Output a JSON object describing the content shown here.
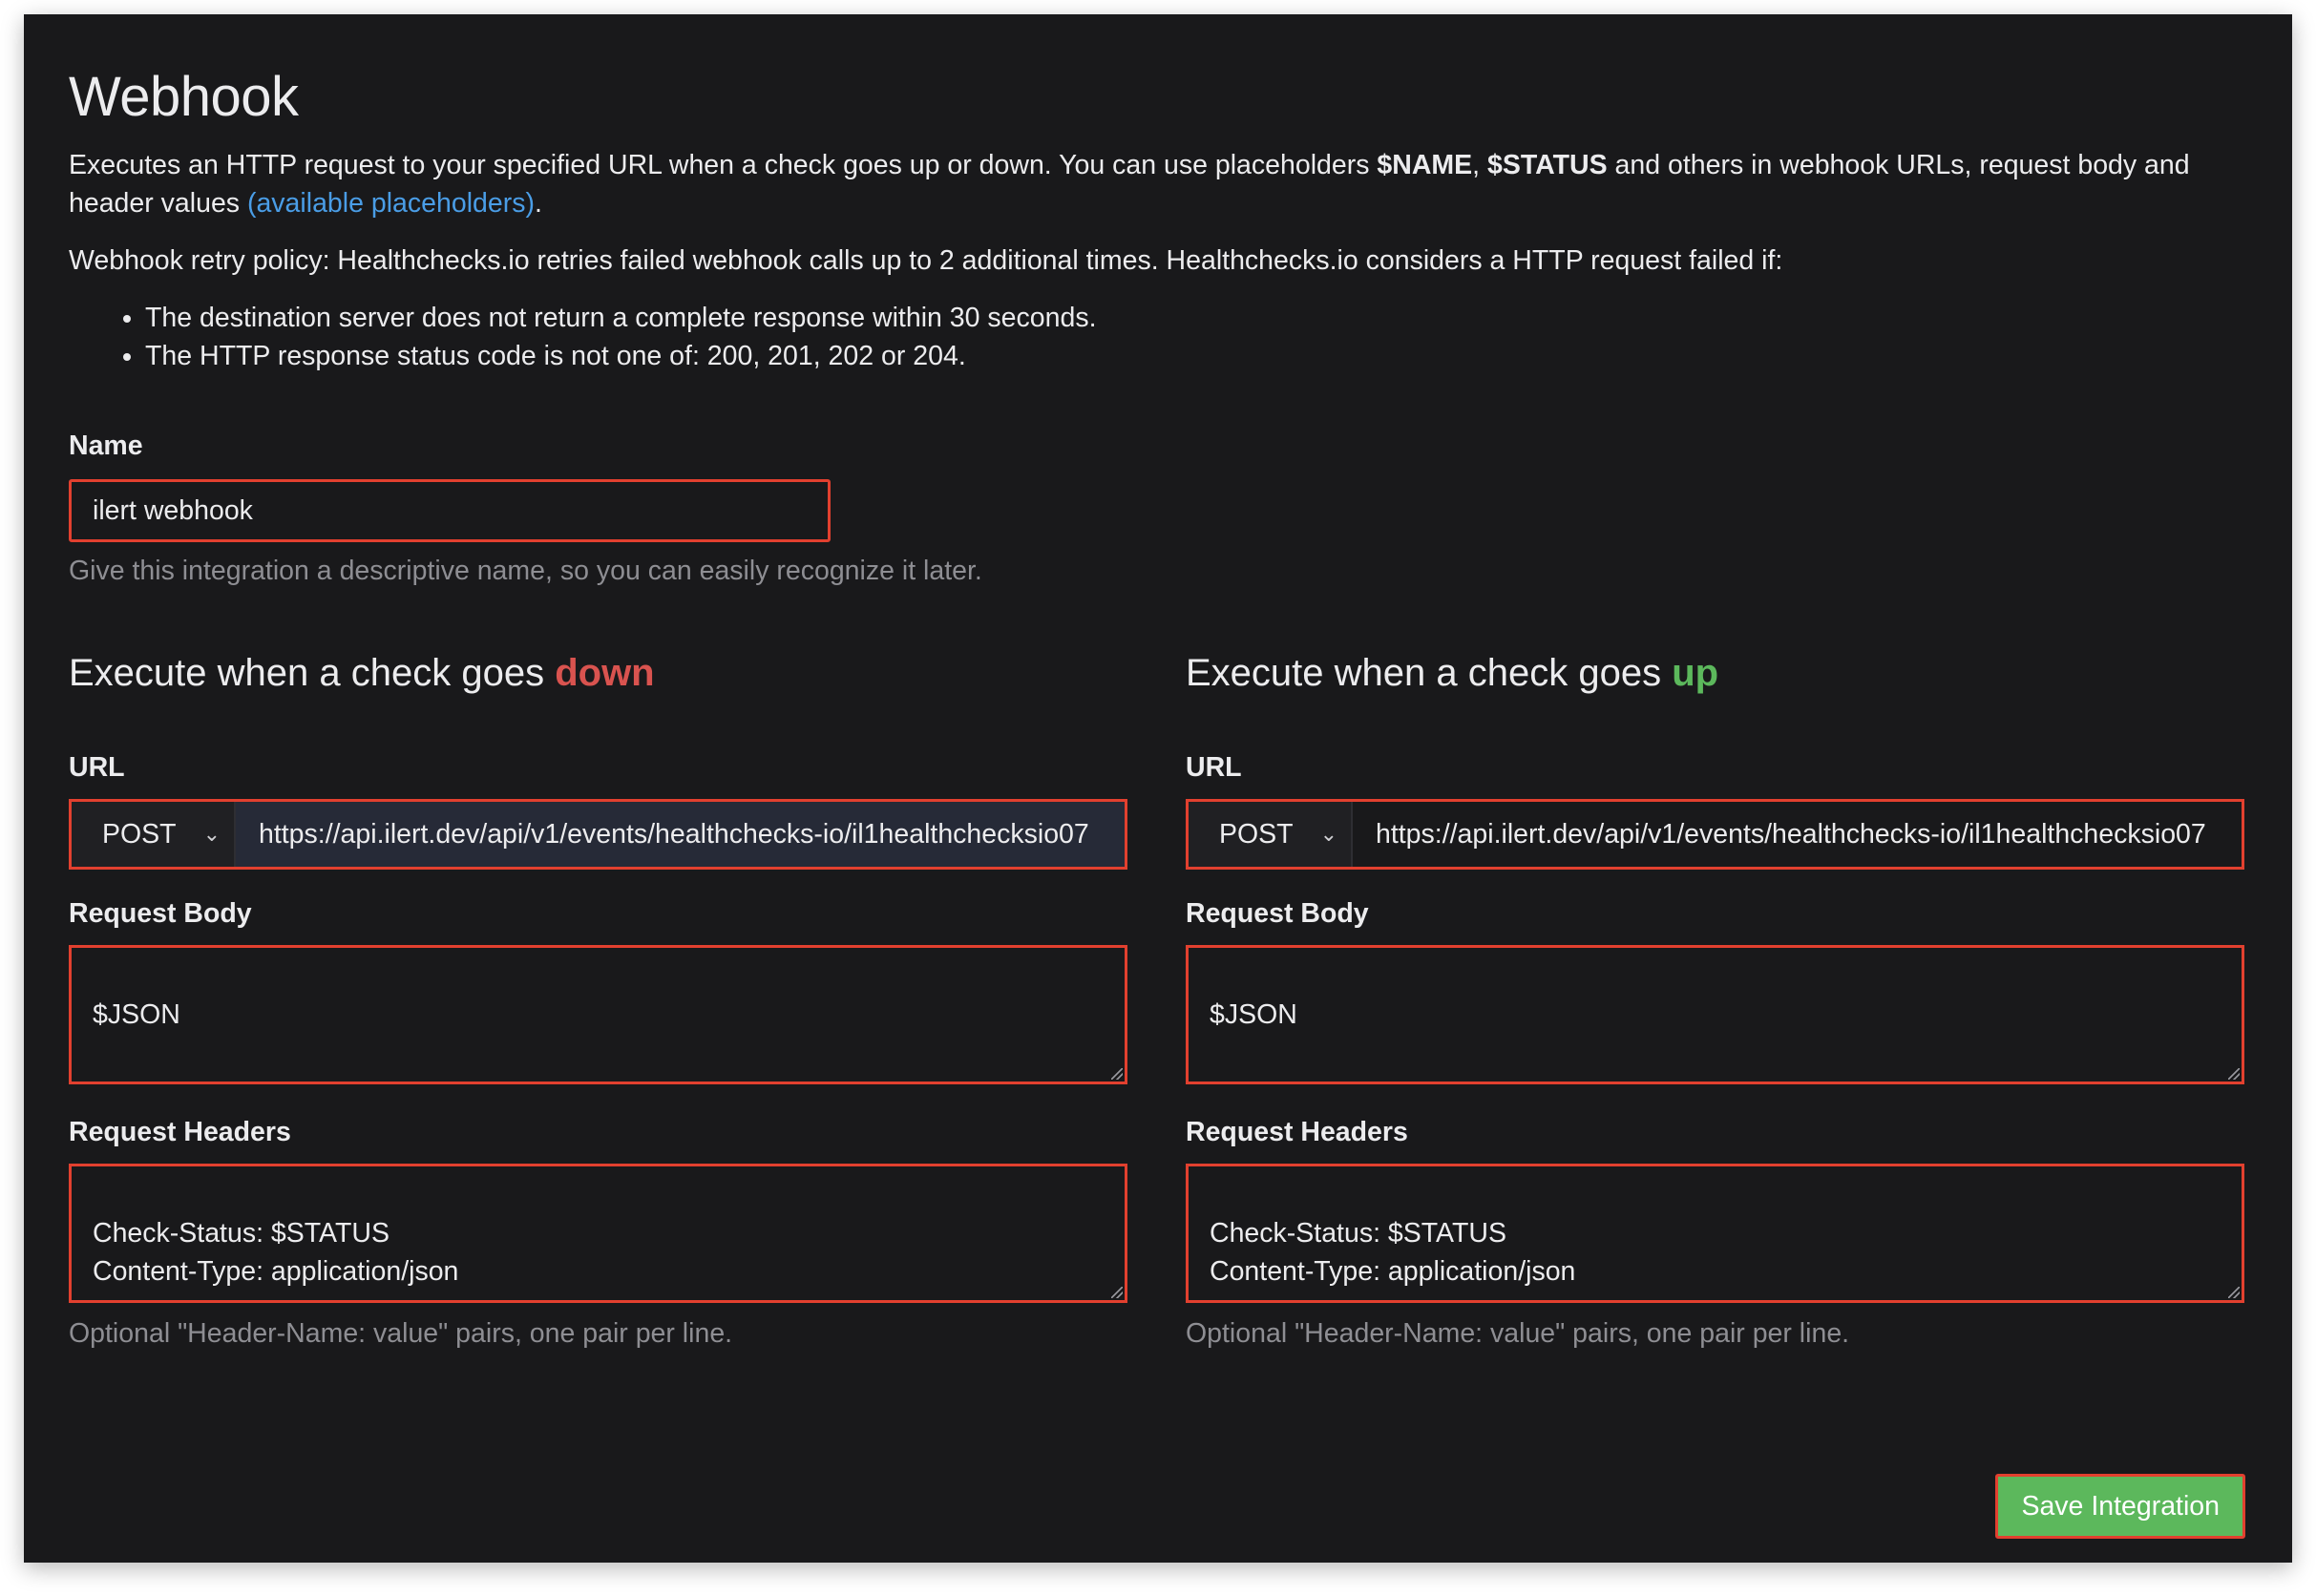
{
  "page": {
    "title": "Webhook",
    "desc": {
      "part1": "Executes an HTTP request to your specified URL when a check goes up or down. You can use placeholders ",
      "var_name": "$NAME",
      "sep": ", ",
      "var_status": "$STATUS",
      "part2": " and others in webhook URLs, request body and header values ",
      "link": "(available placeholders)",
      "end": "."
    },
    "retry": "Webhook retry policy: Healthchecks.io retries failed webhook calls up to 2 additional times. Healthchecks.io considers a HTTP request failed if:",
    "bullets": [
      "The destination server does not return a complete response within 30 seconds.",
      "The HTTP response status code is not one of: 200, 201, 202 or 204."
    ]
  },
  "name_field": {
    "label": "Name",
    "value": "ilert webhook",
    "help": "Give this integration a descriptive name, so you can easily recognize it later."
  },
  "down": {
    "heading_prefix": "Execute when a check goes ",
    "heading_state": "down",
    "url_label": "URL",
    "method": "POST",
    "url": "https://api.ilert.dev/api/v1/events/healthchecks-io/il1healthchecksio07",
    "body_label": "Request Body",
    "body": "$JSON",
    "headers_label": "Request Headers",
    "headers": "Check-Status: $STATUS\nContent-Type: application/json",
    "headers_help": "Optional \"Header-Name: value\" pairs, one pair per line."
  },
  "up": {
    "heading_prefix": "Execute when a check goes ",
    "heading_state": "up",
    "url_label": "URL",
    "method": "POST",
    "url": "https://api.ilert.dev/api/v1/events/healthchecks-io/il1healthchecksio07",
    "body_label": "Request Body",
    "body": "$JSON",
    "headers_label": "Request Headers",
    "headers": "Check-Status: $STATUS\nContent-Type: application/json",
    "headers_help": "Optional \"Header-Name: value\" pairs, one pair per line."
  },
  "save_button": "Save Integration",
  "colors": {
    "background": "#19191b",
    "highlight_border": "#e2402f",
    "link": "#4a9de6",
    "down": "#d9534f",
    "up": "#5cb85c",
    "save_button": "#5cb85c"
  },
  "icons": {
    "method_dropdown": "chevron-down-icon"
  }
}
